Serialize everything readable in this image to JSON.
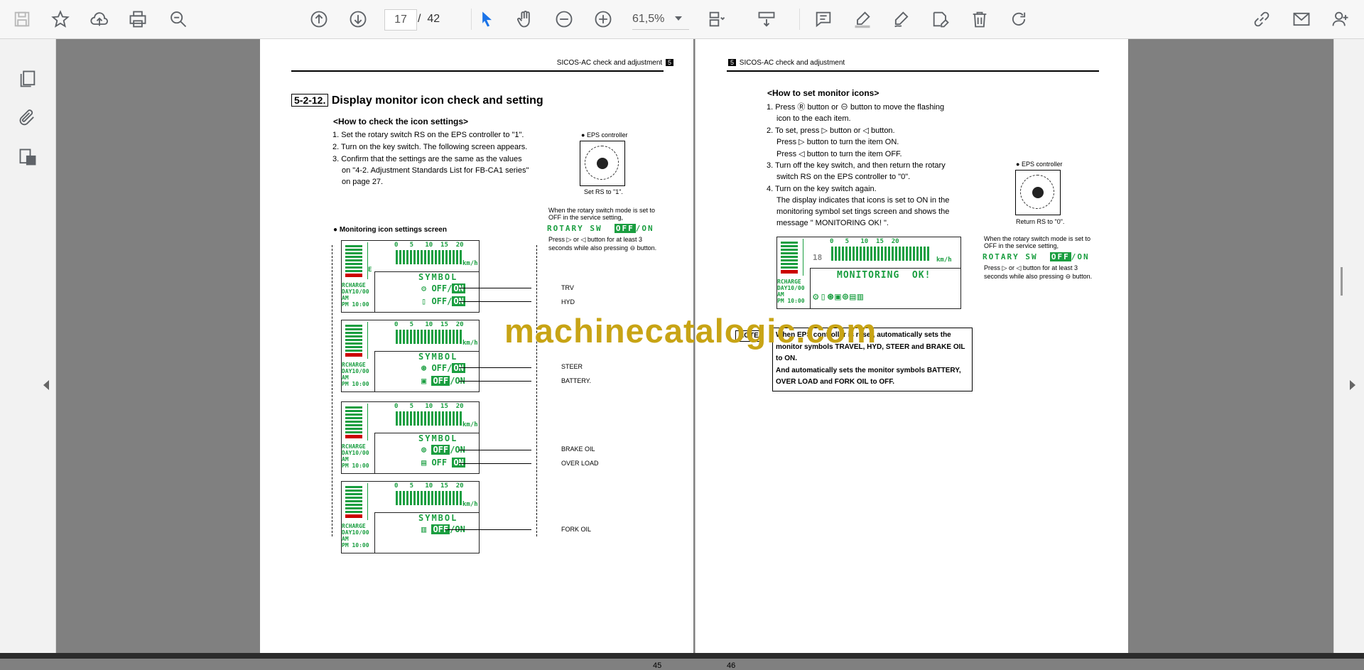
{
  "toolbar": {
    "current_page": "17",
    "page_separator": "/",
    "total_pages": "42",
    "zoom": "61,5%"
  },
  "page45": {
    "header": "SICOS-AC check and adjustment",
    "header_num": "5",
    "section_num": "5-2-12.",
    "section_title": "Display monitor icon check and setting",
    "how_to_check": "<How to check the icon settings>",
    "steps": [
      "1. Set the rotary switch RS on the EPS controller to \"1\".",
      "2. Turn on the key switch. The following screen appears.",
      "3. Confirm that the settings are the same as the values",
      "on \"4-2. Adjustment Standards List for FB-CA1 series\"",
      "on page 27."
    ],
    "eps_label": "EPS controller",
    "set_rs": "Set RS to \"1\".",
    "rotary_note_1": "When the rotary switch mode is set to",
    "rotary_note_2": "OFF in the service setting,",
    "rotary_sw": "ROTARY SW",
    "off": "OFF",
    "on": "ON",
    "press_note_1": "Press",
    "press_note_or": "or",
    "press_note_2": "button for at least 3",
    "press_note_3": "seconds while also pressing",
    "press_note_4": "button.",
    "monitoring_title": "Monitoring icon settings screen",
    "lcd_symbol": "SYMBOL",
    "lcd_speed": "0   5   10  15  20",
    "lcd_kmh": "km/h",
    "lcd_recharge": "RCHARGE",
    "lcd_day": "DAY10/00",
    "lcd_am": "AM",
    "lcd_pm": "PM 10:00",
    "lcd_off_on": "OFF/ON",
    "lcd_f": "F",
    "lcd_e": "E",
    "callouts": [
      "TRV",
      "HYD",
      "STEER",
      "BATTERY.",
      "BRAKE OIL",
      "OVER LOAD",
      "FORK OIL"
    ],
    "page_number": "45"
  },
  "page46": {
    "header": "SICOS-AC check and adjustment",
    "header_num": "5",
    "how_to_set": "<How to set monitor icons>",
    "steps": [
      "1. Press",
      "button or",
      "button to move the flashing",
      "icon to the each item.",
      "2. To set, press",
      "button or",
      "button.",
      "Press",
      "button to turn the item ON.",
      "button to turn the item OFF.",
      "3. Turn off the key switch, and then return the rotary",
      "switch RS on the EPS controller to \"0\".",
      "4. Turn on the key switch again.",
      "The display indicates that icons is set to ON in the",
      "monitoring symbol set tings screen and shows the",
      "message \" MONITORING OK! \"."
    ],
    "eps_label": "EPS controller",
    "return_rs": "Return RS to \"0\".",
    "rotary_note_1": "When the rotary switch mode is set to",
    "rotary_note_2": "OFF in the service setting,",
    "press_note_2": "button for at least 3",
    "press_note_3": "seconds while also pressing",
    "press_note_4": "button.",
    "monitoring_ok": "MONITORING  OK!",
    "lcd_value": "18",
    "note_label": "NOTE",
    "note_lines": [
      "When EPS controller is reset, automatically sets the",
      "monitor symbols TRAVEL, HYD, STEER and BRAKE OIL",
      "to ON.",
      "And automatically sets the monitor symbols BATTERY,",
      "OVER LOAD and FORK OIL to OFF."
    ],
    "page_number": "46"
  },
  "watermark": "machinecatalogic.com",
  "icons": {
    "toolbar": [
      "save-icon",
      "bookmark-icon",
      "upload-icon",
      "print-icon",
      "zoom-out-search-icon",
      "arrow-up-icon",
      "arrow-down-icon",
      "select-cursor-icon",
      "hand-icon",
      "zoom-out-icon",
      "zoom-in-icon",
      "fit-page-icon",
      "scroll-mode-icon",
      "comment-icon",
      "highlight-icon",
      "draw-icon",
      "edit-text-icon",
      "delete-icon",
      "redo-icon",
      "link-icon",
      "mail-icon",
      "add-user-icon"
    ],
    "sidebar": [
      "thumbnails-icon",
      "attachment-icon",
      "layers-icon"
    ]
  },
  "colors": {
    "lcd_green": "#1a9e40",
    "watermark": "#c8a415"
  }
}
